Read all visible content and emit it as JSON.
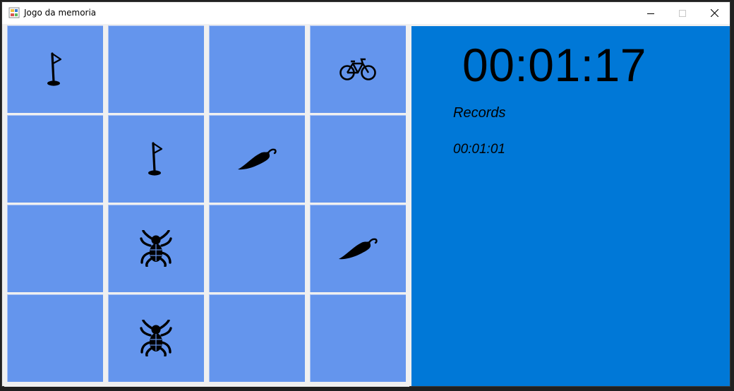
{
  "window": {
    "title": "Jogo da memoria",
    "controls": [
      "minimize",
      "maximize",
      "close"
    ]
  },
  "board": {
    "rows": 4,
    "cols": 4,
    "cards": [
      {
        "icon": "golf-flag-icon"
      },
      {
        "icon": ""
      },
      {
        "icon": ""
      },
      {
        "icon": "bicycle-icon"
      },
      {
        "icon": ""
      },
      {
        "icon": "golf-flag-icon"
      },
      {
        "icon": "chili-pepper-icon"
      },
      {
        "icon": ""
      },
      {
        "icon": ""
      },
      {
        "icon": "spider-icon"
      },
      {
        "icon": ""
      },
      {
        "icon": "chili-pepper-icon"
      },
      {
        "icon": ""
      },
      {
        "icon": "spider-icon"
      },
      {
        "icon": ""
      },
      {
        "icon": ""
      }
    ]
  },
  "panel": {
    "timer": "00:01:17",
    "records_title": "Records",
    "records": [
      "00:01:01"
    ]
  },
  "colors": {
    "card": "#6495ed",
    "panel": "#0078d7",
    "window_bg": "#f0f0f0"
  }
}
